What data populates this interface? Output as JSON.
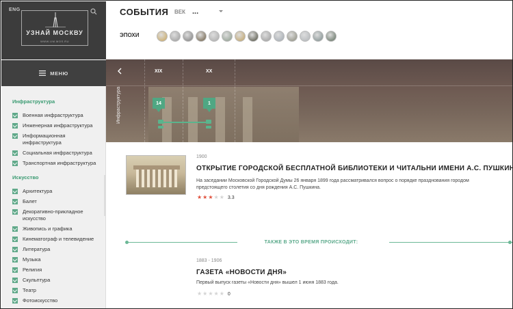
{
  "header": {
    "lang": "ENG",
    "logo_text": "УЗНАЙ МОСКВУ",
    "logo_url": "WWW.UM.MOS.RU",
    "title": "СОБЫТИЯ",
    "century_label": "ВЕК",
    "century_value": "...",
    "eras_label": "ЭПОХИ",
    "era_colors": [
      "#c9a55a",
      "#9a9a9a",
      "#7b7b7b",
      "#6a5a40",
      "#aaaaaa",
      "#8a9a8a",
      "#c0a060",
      "#4a4a3a",
      "#9a9a9a",
      "#a0a8b0",
      "#8a8a7a",
      "#b0b4b8",
      "#7a8a8a",
      "#5a6a5a"
    ]
  },
  "menu": {
    "label": "МЕНЮ"
  },
  "sidebar": {
    "sections": [
      {
        "title": "Инфраструктура",
        "items": [
          "Военная инфраструктура",
          "Инженерная инфраструктура",
          "Информационная инфраструктура",
          "Социальная инфраструктура",
          "Транспортная инфраструктура"
        ]
      },
      {
        "title": "Искусство",
        "items": [
          "Архитектура",
          "Балет",
          "Декоративно-прикладное искусство",
          "Живопись и графика",
          "Кинематограф и телевидение",
          "Литература",
          "Музыка",
          "Религия",
          "Скульптура",
          "Театр",
          "Фотоискусство"
        ]
      }
    ]
  },
  "timeline": {
    "category": "Инфраструктура",
    "centuries": [
      "XIX",
      "XX"
    ],
    "markers": [
      "14",
      "1"
    ]
  },
  "events": [
    {
      "year": "1900",
      "title": "ОТКРЫТИЕ ГОРОДСКОЙ БЕСПЛАТНОЙ БИБЛИОТЕКИ И ЧИТАЛЬНИ ИМЕНИ А.С. ПУШКИНА",
      "description": "На заседании Московской Городской Думы 26 января 1899 года рассматривался вопрос о порядке празднования городом предстоящего столетия со дня рождения А.С. Пушкина.",
      "rating": "3.3",
      "stars": 3
    }
  ],
  "also_label": "ТАКЖЕ В ЭТО ВРЕМЯ ПРОИСХОДИТ:",
  "related": [
    {
      "year": "1883 - 1906",
      "title": "ГАЗЕТА «НОВОСТИ ДНЯ»",
      "description": "Первый выпуск газеты «Новости дня» вышел 1 июня 1883 года.",
      "rating": "0",
      "stars": 0
    }
  ]
}
